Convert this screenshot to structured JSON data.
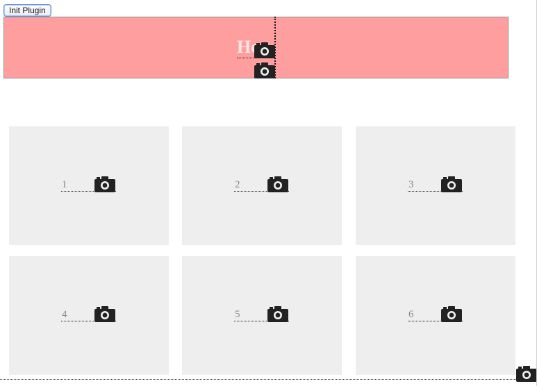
{
  "toolbar": {
    "init_label": "Init Plugin"
  },
  "banner": {
    "text": "He",
    "bg_color": "#ff9e9e"
  },
  "grid": {
    "card_bg": "#eeeeee",
    "items": [
      {
        "label": "1",
        "icon": "camera-icon"
      },
      {
        "label": "2",
        "icon": "camera-icon"
      },
      {
        "label": "3",
        "icon": "camera-icon"
      },
      {
        "label": "4",
        "icon": "camera-icon"
      },
      {
        "label": "5",
        "icon": "camera-icon"
      },
      {
        "label": "6",
        "icon": "camera-icon"
      }
    ]
  }
}
